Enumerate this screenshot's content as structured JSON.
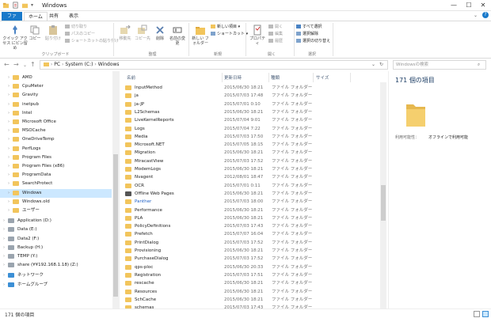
{
  "window": {
    "title": "Windows",
    "controls": {
      "minimize": "—",
      "maximize": "☐",
      "close": "✕"
    }
  },
  "tabs": [
    "ファイル",
    "ホーム",
    "共有",
    "表示"
  ],
  "ribbon": {
    "clipboard": {
      "group": "クリップボード",
      "pin": "クイック アクセス にピン留め",
      "copy": "コピー",
      "paste": "貼り付け",
      "cut": "切り取り",
      "copy_path": "パスのコピー",
      "paste_shortcut": "ショートカットの貼り付け"
    },
    "organize": {
      "group": "整理",
      "move": "移動先",
      "copy_to": "コピー先",
      "delete": "削除",
      "rename": "名前の変更"
    },
    "new": {
      "group": "新規",
      "new_folder": "新しい フォルダー",
      "new_item": "新しい項目",
      "shortcut": "ショートカット"
    },
    "open": {
      "group": "開く",
      "properties": "プロパティ",
      "open": "開く",
      "edit": "編集",
      "history": "履歴"
    },
    "select": {
      "group": "選択",
      "select_all": "すべて選択",
      "select_none": "選択解除",
      "invert": "選択の切り替え"
    }
  },
  "address": {
    "path": [
      "PC",
      "System (C:)",
      "Windows"
    ],
    "search_placeholder": "Windowsの検索",
    "arrow_sep": "›"
  },
  "nav_pane": {
    "items": [
      {
        "label": "AMD",
        "kind": "folder"
      },
      {
        "label": "CpuMeter",
        "kind": "folder"
      },
      {
        "label": "Gravity",
        "kind": "folder"
      },
      {
        "label": "inetpub",
        "kind": "folder"
      },
      {
        "label": "Intel",
        "kind": "folder"
      },
      {
        "label": "Microsoft Office",
        "kind": "folder"
      },
      {
        "label": "MSOCache",
        "kind": "folder"
      },
      {
        "label": "OneDriveTemp",
        "kind": "folder"
      },
      {
        "label": "PerfLogs",
        "kind": "folder"
      },
      {
        "label": "Program Files",
        "kind": "folder"
      },
      {
        "label": "Program Files (x86)",
        "kind": "folder"
      },
      {
        "label": "ProgramData",
        "kind": "folder"
      },
      {
        "label": "SearchProtect",
        "kind": "folder"
      },
      {
        "label": "Windows",
        "kind": "folder",
        "selected": true
      },
      {
        "label": "Windows.old",
        "kind": "folder"
      },
      {
        "label": "ユーザー",
        "kind": "folder"
      },
      {
        "label": "Application (D:)",
        "kind": "drive"
      },
      {
        "label": "Data (E:)",
        "kind": "drive"
      },
      {
        "label": "Data2 (F:)",
        "kind": "drive"
      },
      {
        "label": "Backup (H:)",
        "kind": "drive"
      },
      {
        "label": "TEMP (Y:)",
        "kind": "drive"
      },
      {
        "label": "share (¥¥192.168.1.18) (Z:)",
        "kind": "drive"
      },
      {
        "label": "ネットワーク",
        "kind": "network"
      },
      {
        "label": "ホームグループ",
        "kind": "home"
      }
    ]
  },
  "list": {
    "columns": [
      "名前",
      "更新日時",
      "種類",
      "サイズ"
    ],
    "rows": [
      {
        "name": "InputMethod",
        "date": "2015/06/30 18:21",
        "type": "ファイル フォルダー"
      },
      {
        "name": "ja",
        "date": "2015/07/03 17:48",
        "type": "ファイル フォルダー"
      },
      {
        "name": "ja-JP",
        "date": "2015/07/01 0:10",
        "type": "ファイル フォルダー"
      },
      {
        "name": "L2Schemas",
        "date": "2015/06/30 18:21",
        "type": "ファイル フォルダー"
      },
      {
        "name": "LiveKernelReports",
        "date": "2015/07/04 9:01",
        "type": "ファイル フォルダー"
      },
      {
        "name": "Logs",
        "date": "2015/07/04 7:22",
        "type": "ファイル フォルダー"
      },
      {
        "name": "Media",
        "date": "2015/07/03 17:50",
        "type": "ファイル フォルダー"
      },
      {
        "name": "Microsoft.NET",
        "date": "2015/07/05 18:15",
        "type": "ファイル フォルダー"
      },
      {
        "name": "Migration",
        "date": "2015/06/30 18:21",
        "type": "ファイル フォルダー"
      },
      {
        "name": "MiracastView",
        "date": "2015/07/03 17:52",
        "type": "ファイル フォルダー"
      },
      {
        "name": "ModemLogs",
        "date": "2015/06/30 18:21",
        "type": "ファイル フォルダー"
      },
      {
        "name": "Nvagent",
        "date": "2012/08/01 18:47",
        "type": "ファイル フォルダー"
      },
      {
        "name": "OCR",
        "date": "2015/07/01 0:11",
        "type": "ファイル フォルダー"
      },
      {
        "name": "Offline Web Pages",
        "date": "2015/06/30 18:21",
        "type": "ファイル フォルダー",
        "sys": true
      },
      {
        "name": "Panther",
        "date": "2015/07/03 18:00",
        "type": "ファイル フォルダー",
        "blue": true
      },
      {
        "name": "Performance",
        "date": "2015/06/30 18:21",
        "type": "ファイル フォルダー"
      },
      {
        "name": "PLA",
        "date": "2015/06/30 18:21",
        "type": "ファイル フォルダー"
      },
      {
        "name": "PolicyDefinitions",
        "date": "2015/07/03 17:43",
        "type": "ファイル フォルダー"
      },
      {
        "name": "Prefetch",
        "date": "2015/07/07 16:04",
        "type": "ファイル フォルダー"
      },
      {
        "name": "PrintDialog",
        "date": "2015/07/03 17:52",
        "type": "ファイル フォルダー"
      },
      {
        "name": "Provisioning",
        "date": "2015/06/30 18:21",
        "type": "ファイル フォルダー"
      },
      {
        "name": "PurchaseDialog",
        "date": "2015/07/03 17:52",
        "type": "ファイル フォルダー"
      },
      {
        "name": "qps-ploc",
        "date": "2015/06/30 20:33",
        "type": "ファイル フォルダー"
      },
      {
        "name": "Registration",
        "date": "2015/07/03 17:51",
        "type": "ファイル フォルダー"
      },
      {
        "name": "rescache",
        "date": "2015/06/30 18:21",
        "type": "ファイル フォルダー"
      },
      {
        "name": "Resources",
        "date": "2015/06/30 18:21",
        "type": "ファイル フォルダー"
      },
      {
        "name": "SchCache",
        "date": "2015/06/30 18:21",
        "type": "ファイル フォルダー"
      },
      {
        "name": "schemas",
        "date": "2015/07/03 17:43",
        "type": "ファイル フォルダー"
      }
    ]
  },
  "preview": {
    "title": "171 個の項目",
    "availability_label": "利用可能性：",
    "availability_value": "オフラインで利用可能"
  },
  "status": {
    "count": "171 個の項目"
  },
  "colors": {
    "accent": "#1979ca",
    "selection": "#cce8ff",
    "folder": "#f2c55c"
  }
}
